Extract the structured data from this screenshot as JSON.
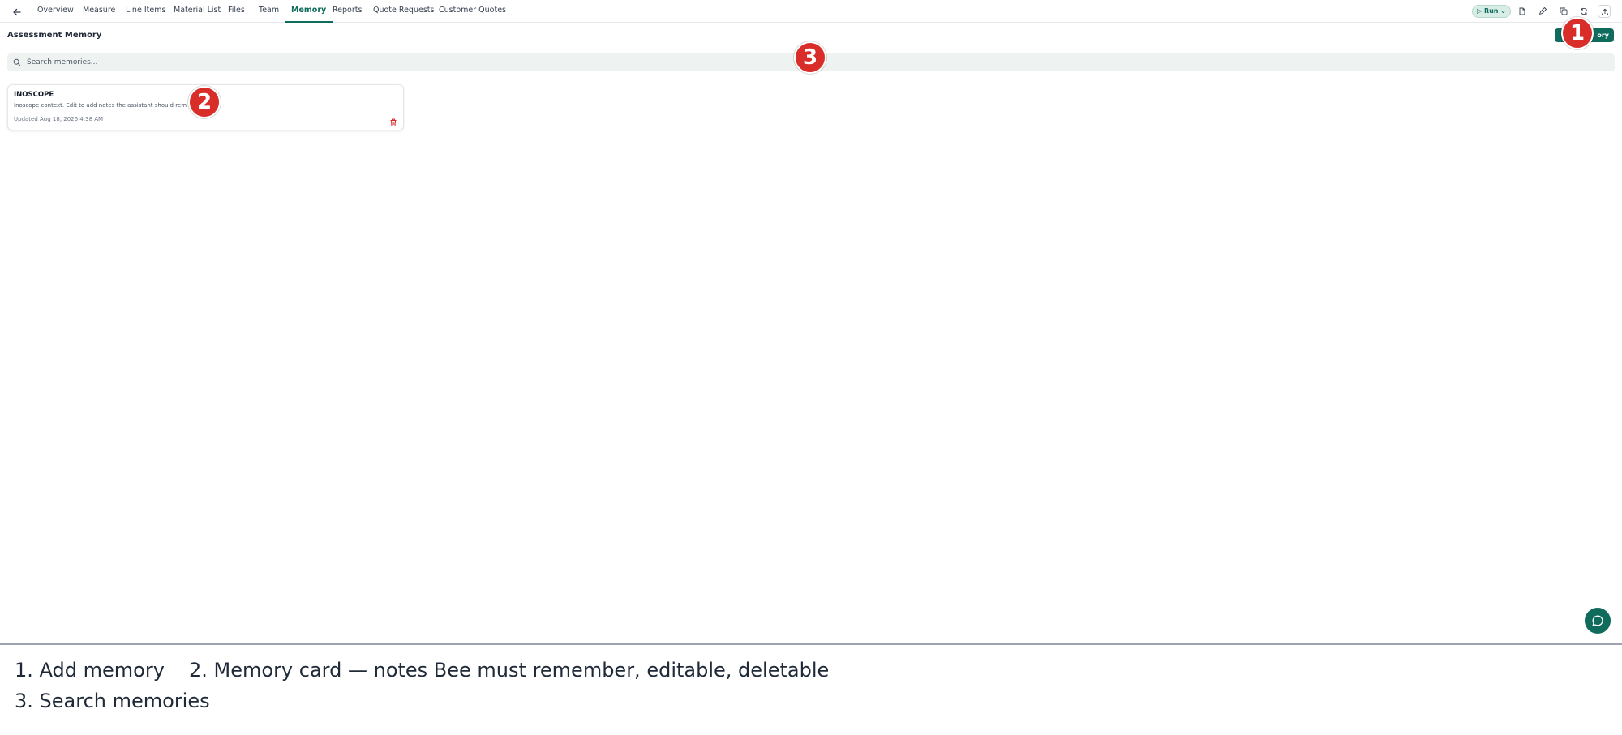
{
  "nav": {
    "tabs": [
      {
        "label": "Overview"
      },
      {
        "label": "Measure"
      },
      {
        "label": "Line Items"
      },
      {
        "label": "Material List"
      },
      {
        "label": "Files"
      },
      {
        "label": "Team"
      },
      {
        "label": "Memory",
        "active": true
      },
      {
        "label": "Reports"
      },
      {
        "label": "Quote Requests"
      },
      {
        "label": "Customer Quotes"
      }
    ],
    "run_label": "Run",
    "tools": [
      "document-icon",
      "pencil-icon",
      "copy-icon",
      "refresh-icon",
      "upload-icon"
    ]
  },
  "page": {
    "title": "Assessment Memory",
    "add_button_label": "ory"
  },
  "search": {
    "placeholder": "Search memories..."
  },
  "memories": [
    {
      "title": "INOSCOPE",
      "body": "Inoscope context. Edit to add notes the assistant should rem",
      "updated": "Updated Aug 18, 2026 4:38 AM"
    }
  ],
  "markers": [
    "1",
    "2",
    "3"
  ],
  "captions": {
    "line1_item1": "1. Add memory",
    "line1_item2": "2. Memory card — notes Bee must remember, editable, deletable",
    "line2_item1": "3. Search memories"
  },
  "colors": {
    "accent": "#0f6b5c",
    "marker": "#d92d2a",
    "delete": "#dc2626"
  }
}
